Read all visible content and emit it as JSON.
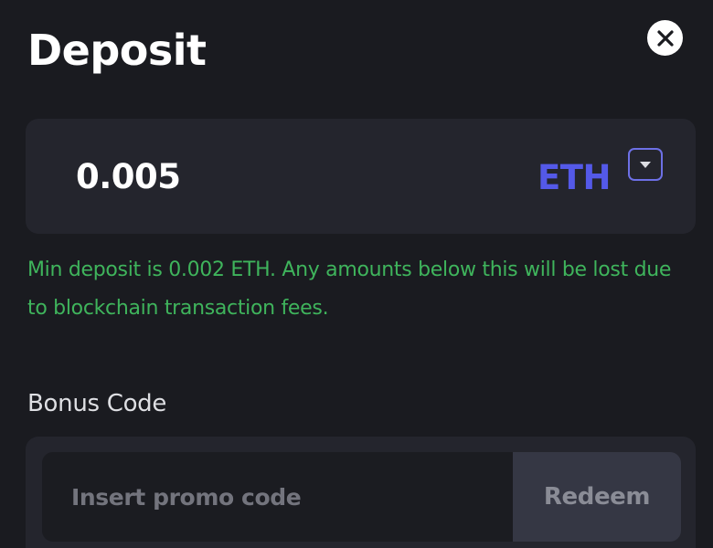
{
  "header": {
    "title": "Deposit",
    "close_icon": "close-icon"
  },
  "amount": {
    "value": "0.005",
    "currency": "ETH",
    "currency_color": "#5459e8",
    "toggle_icon": "chevron-down-icon"
  },
  "notice": {
    "text": "Min deposit is 0.002 ETH. Any amounts below this will be lost due to blockchain transaction fees.",
    "color": "#3fb45c"
  },
  "bonus": {
    "label": "Bonus Code",
    "input_value": "",
    "input_placeholder": "Insert promo code",
    "redeem_label": "Redeem"
  },
  "colors": {
    "background": "#1a1b20",
    "panel": "#24252d",
    "accent": "#5459e8"
  }
}
